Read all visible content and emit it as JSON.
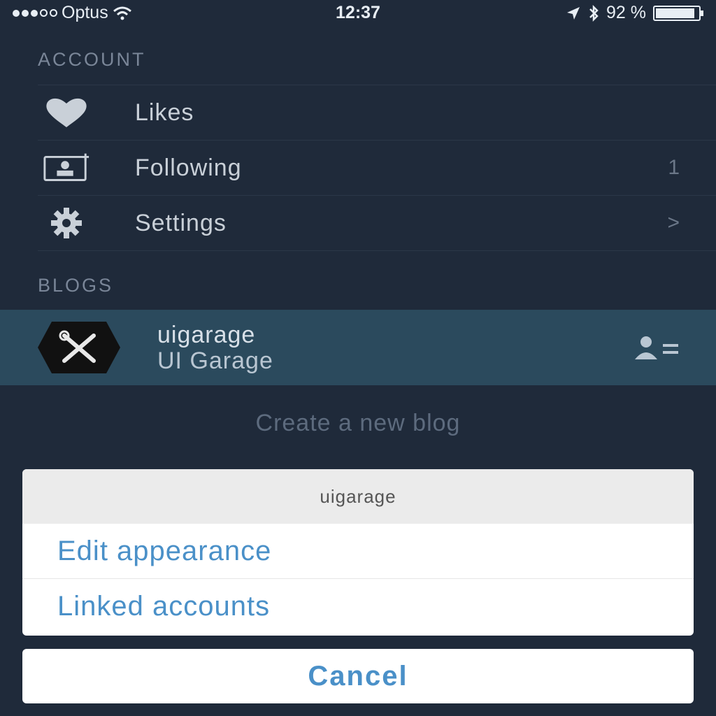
{
  "status_bar": {
    "carrier": "Optus",
    "time": "12:37",
    "battery": "92 %",
    "battery_level": 0.92
  },
  "account": {
    "section_title": "ACCOUNT",
    "items": [
      {
        "label": "Likes",
        "icon": "heart-icon",
        "meta": ""
      },
      {
        "label": "Following",
        "icon": "following-icon",
        "meta": "1"
      },
      {
        "label": "Settings",
        "icon": "gear-icon",
        "meta": ">"
      }
    ]
  },
  "blogs": {
    "section_title": "BLOGS",
    "current": {
      "name": "uigarage",
      "subtitle": "UI Garage"
    },
    "create_label": "Create a new blog"
  },
  "action_sheet": {
    "title": "uigarage",
    "items": [
      "Edit appearance",
      "Linked accounts"
    ],
    "cancel_label": "Cancel"
  },
  "colors": {
    "background": "#1f2a3a",
    "selected_row": "#2b4a5d",
    "action_text": "#4a90c8"
  }
}
